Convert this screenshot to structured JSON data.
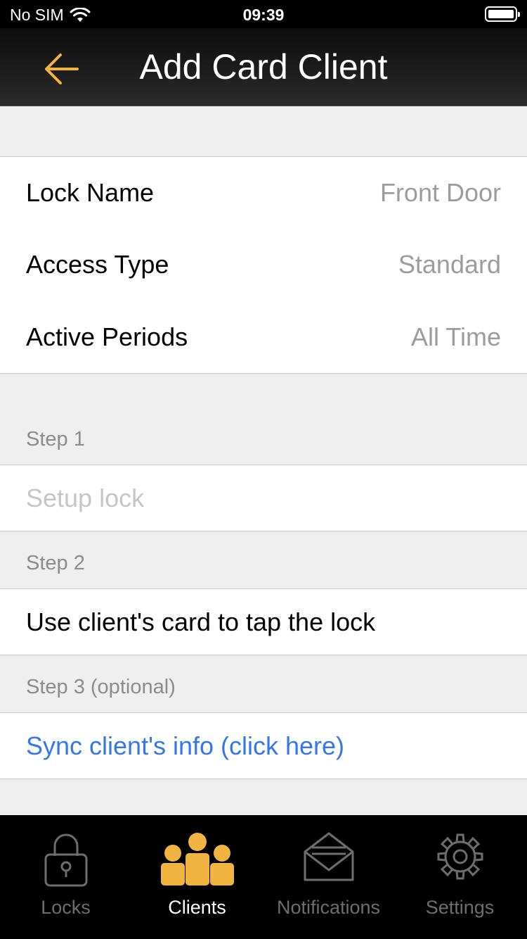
{
  "status_bar": {
    "carrier": "No SIM",
    "time": "09:39"
  },
  "nav": {
    "title": "Add Card Client"
  },
  "form": {
    "lock_name": {
      "label": "Lock Name",
      "value": "Front Door"
    },
    "access_type": {
      "label": "Access Type",
      "value": "Standard"
    },
    "active_periods": {
      "label": "Active Periods",
      "value": "All Time"
    }
  },
  "steps": [
    {
      "header": "Step 1",
      "text": "Setup lock",
      "state": "disabled"
    },
    {
      "header": "Step 2",
      "text": "Use client's card to tap the lock",
      "state": "normal"
    },
    {
      "header": "Step 3 (optional)",
      "text": "Sync client's info (click here)",
      "state": "link"
    }
  ],
  "tabs": [
    {
      "label": "Locks",
      "icon": "lock-icon",
      "active": false
    },
    {
      "label": "Clients",
      "icon": "clients-icon",
      "active": true
    },
    {
      "label": "Notifications",
      "icon": "envelope-icon",
      "active": false
    },
    {
      "label": "Settings",
      "icon": "gear-icon",
      "active": false
    }
  ],
  "colors": {
    "accent": "#f2b441",
    "link": "#3478e5",
    "inactive_tab": "#6d6d6d",
    "disabled_text": "#c6c6c6"
  }
}
